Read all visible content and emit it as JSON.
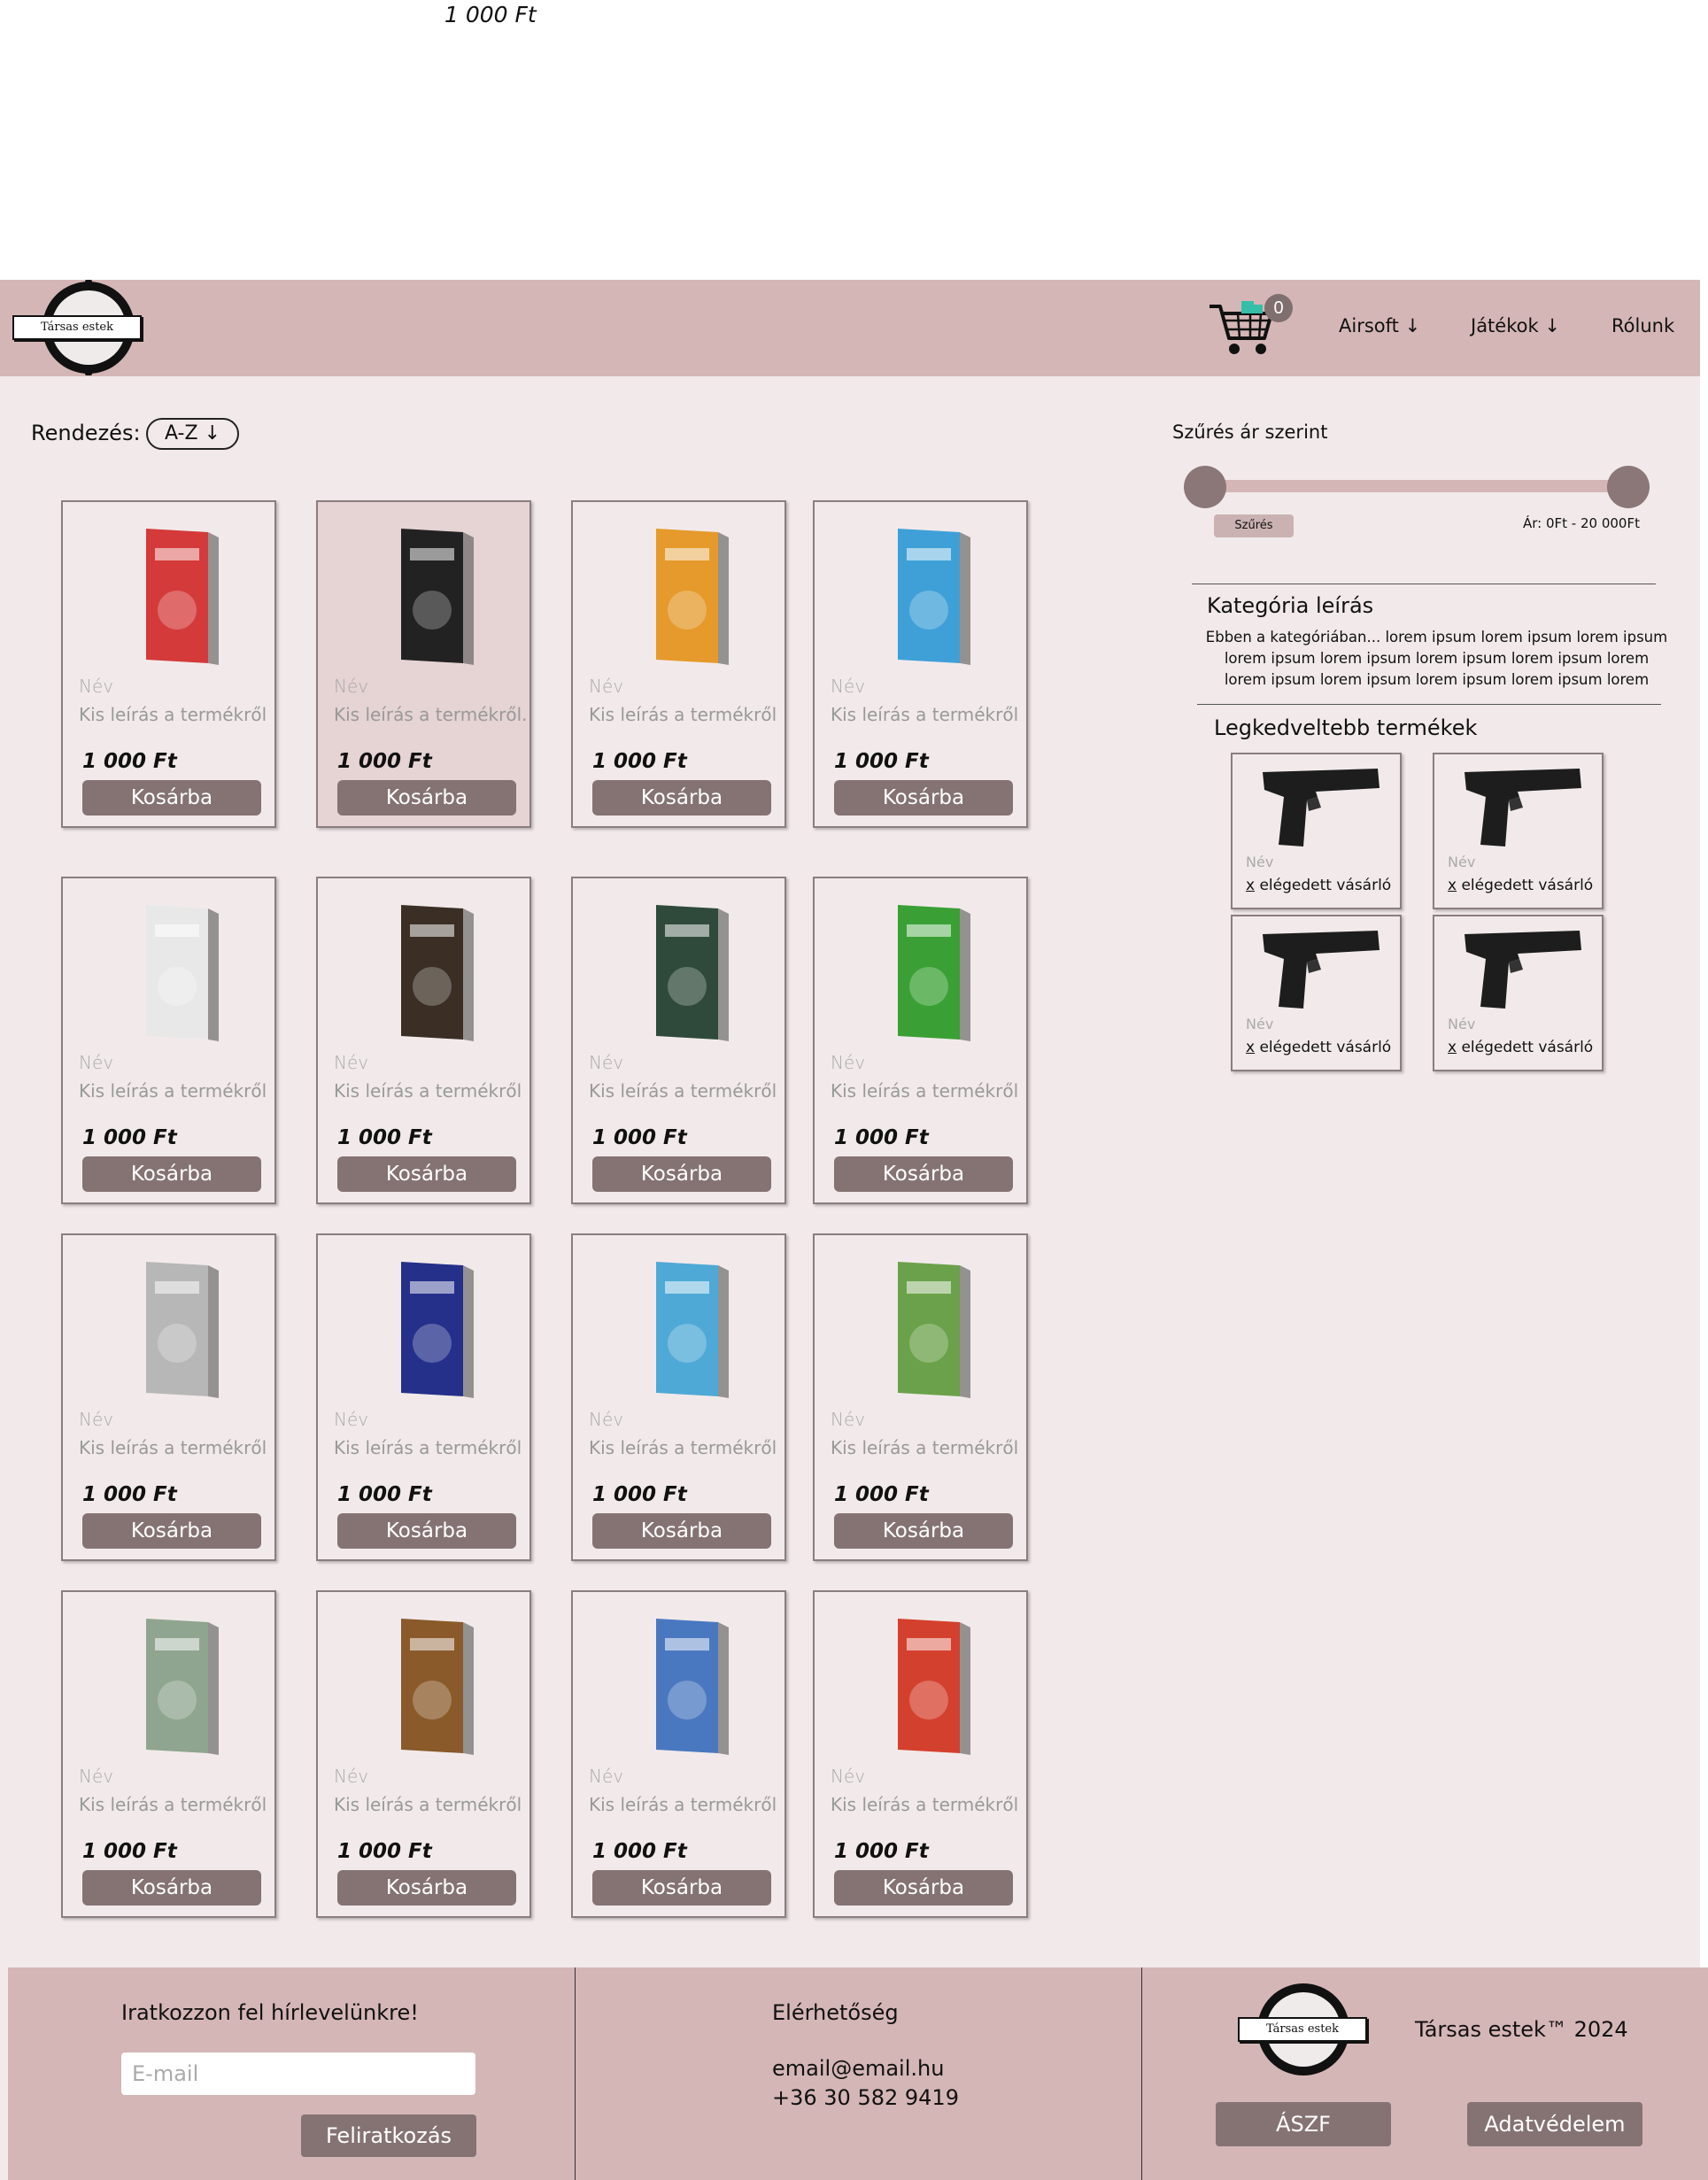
{
  "stray_price": "1 000 Ft",
  "header": {
    "logo_text": "Társas estek",
    "cart_count": "0",
    "nav": [
      {
        "label": "Airsoft",
        "arrow": "↓"
      },
      {
        "label": "Játékok",
        "arrow": "↓"
      },
      {
        "label": "Rólunk"
      }
    ]
  },
  "sort": {
    "label": "Rendezés:",
    "value": "A-Z",
    "arrow": "↓"
  },
  "products": [
    {
      "name": "Név",
      "desc": "Kis leírás a termékről",
      "price": "1 000 Ft",
      "button": "Kosárba",
      "box_color": "#d43a3a",
      "highlighted": false
    },
    {
      "name": "Név",
      "desc": "Kis leírás a termékről.",
      "price": "1 000 Ft",
      "button": "Kosárba",
      "box_color": "#222222",
      "highlighted": true
    },
    {
      "name": "Név",
      "desc": "Kis leírás a termékről",
      "price": "1 000 Ft",
      "button": "Kosárba",
      "box_color": "#e59a2b",
      "highlighted": false
    },
    {
      "name": "Név",
      "desc": "Kis leírás a termékről",
      "price": "1 000 Ft",
      "button": "Kosárba",
      "box_color": "#3fa0d8",
      "highlighted": false
    },
    {
      "name": "Név",
      "desc": "Kis leírás a termékről",
      "price": "1 000 Ft",
      "button": "Kosárba",
      "box_color": "#e8e8e8",
      "highlighted": false
    },
    {
      "name": "Név",
      "desc": "Kis leírás a termékről",
      "price": "1 000 Ft",
      "button": "Kosárba",
      "box_color": "#3b2f25",
      "highlighted": false
    },
    {
      "name": "Név",
      "desc": "Kis leírás a termékről",
      "price": "1 000 Ft",
      "button": "Kosárba",
      "box_color": "#2f4a3a",
      "highlighted": false
    },
    {
      "name": "Név",
      "desc": "Kis leírás a termékről",
      "price": "1 000 Ft",
      "button": "Kosárba",
      "box_color": "#3aa035",
      "highlighted": false
    },
    {
      "name": "Név",
      "desc": "Kis leírás a termékről",
      "price": "1 000 Ft",
      "button": "Kosárba",
      "box_color": "#b7b7b7",
      "highlighted": false
    },
    {
      "name": "Név",
      "desc": "Kis leírás a termékről",
      "price": "1 000 Ft",
      "button": "Kosárba",
      "box_color": "#24308a",
      "highlighted": false
    },
    {
      "name": "Név",
      "desc": "Kis leírás a termékről",
      "price": "1 000 Ft",
      "button": "Kosárba",
      "box_color": "#4ea9d6",
      "highlighted": false
    },
    {
      "name": "Név",
      "desc": "Kis leírás a termékről",
      "price": "1 000 Ft",
      "button": "Kosárba",
      "box_color": "#6aa14a",
      "highlighted": false
    },
    {
      "name": "Név",
      "desc": "Kis leírás a termékről",
      "price": "1 000 Ft",
      "button": "Kosárba",
      "box_color": "#8fa58f",
      "highlighted": false
    },
    {
      "name": "Név",
      "desc": "Kis leírás a termékről",
      "price": "1 000 Ft",
      "button": "Kosárba",
      "box_color": "#8a5a2a",
      "highlighted": false
    },
    {
      "name": "Név",
      "desc": "Kis leírás a termékről",
      "price": "1 000 Ft",
      "button": "Kosárba",
      "box_color": "#4a78c0",
      "highlighted": false
    },
    {
      "name": "Név",
      "desc": "Kis leírás a termékről",
      "price": "1 000 Ft",
      "button": "Kosárba",
      "box_color": "#d4402e",
      "highlighted": false
    }
  ],
  "sidebar": {
    "filter_title": "Szűrés ár szerint",
    "filter_button": "Szűrés",
    "price_range": "Ár: 0Ft - 20 000Ft",
    "category_title": "Kategória leírás",
    "category_desc": "Ebben a kategóriában... lorem ipsum lorem ipsum lorem ipsum lorem ipsum lorem ipsum lorem ipsum lorem ipsum lorem lorem ipsum lorem ipsum lorem ipsum lorem ipsum lorem",
    "popular_title": "Legkedveltebb termékek",
    "popular": [
      {
        "name": "Név",
        "x": "x",
        "sat": " elégedett vásárló"
      },
      {
        "name": "Név",
        "x": "x",
        "sat": " elégedett vásárló"
      },
      {
        "name": "Név",
        "x": "x",
        "sat": " elégedett vásárló"
      },
      {
        "name": "Név",
        "x": "x",
        "sat": " elégedett vásárló"
      }
    ]
  },
  "footer": {
    "newsletter_title": "Iratkozzon fel hírlevelünkre!",
    "email_placeholder": "E-mail",
    "subscribe": "Feliratkozás",
    "contact_title": "Elérhetőség",
    "email": "email@email.hu",
    "phone": "+36 30 582 9419",
    "logo_text": "Társas estek",
    "brand": "Társas estek™ 2024",
    "aszf": "ÁSZF",
    "privacy": "Adatvédelem"
  },
  "colors": {
    "nav_bg": "#d5b6b6",
    "page_bg": "#f2eaea",
    "button": "#857373"
  }
}
